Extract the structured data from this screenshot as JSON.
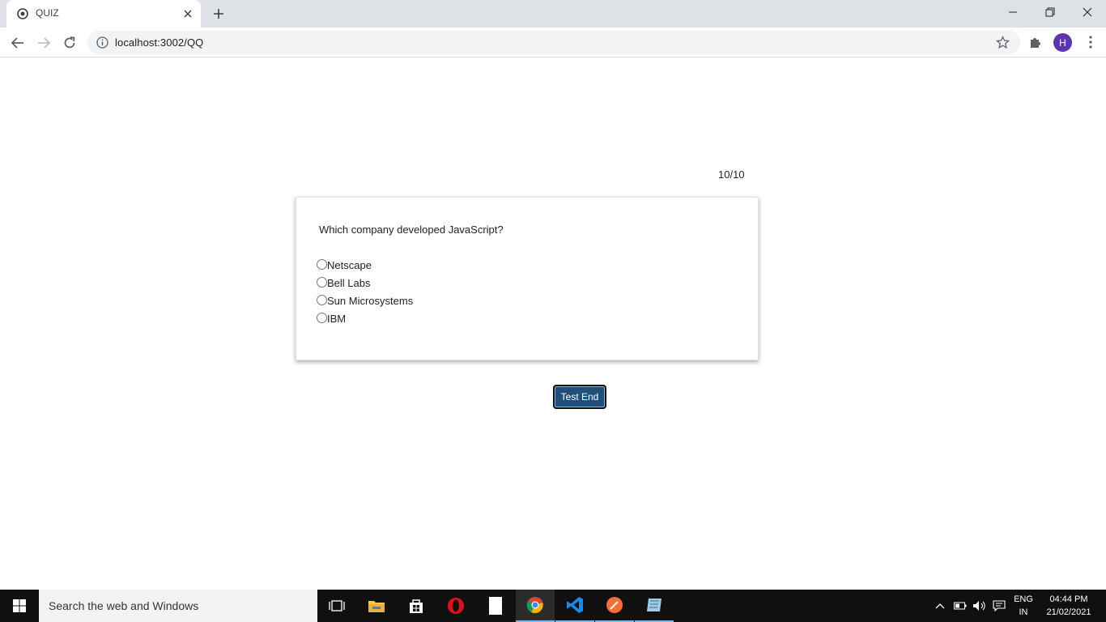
{
  "browser": {
    "tab_title": "QUIZ",
    "url": "localhost:3002/QQ",
    "avatar_letter": "H"
  },
  "quiz": {
    "counter": "10/10",
    "question": "Which company developed JavaScript?",
    "options": [
      "Netscape",
      "Bell Labs",
      "Sun Microsystems",
      "IBM"
    ],
    "end_button": "Test End"
  },
  "taskbar": {
    "search_placeholder": "Search the web and Windows",
    "language": "ENG",
    "region": "IN",
    "time": "04:44 PM",
    "date": "21/02/2021"
  },
  "colors": {
    "accent": "#1f4f7a",
    "avatar": "#5e35b1",
    "taskbar": "#101010"
  }
}
